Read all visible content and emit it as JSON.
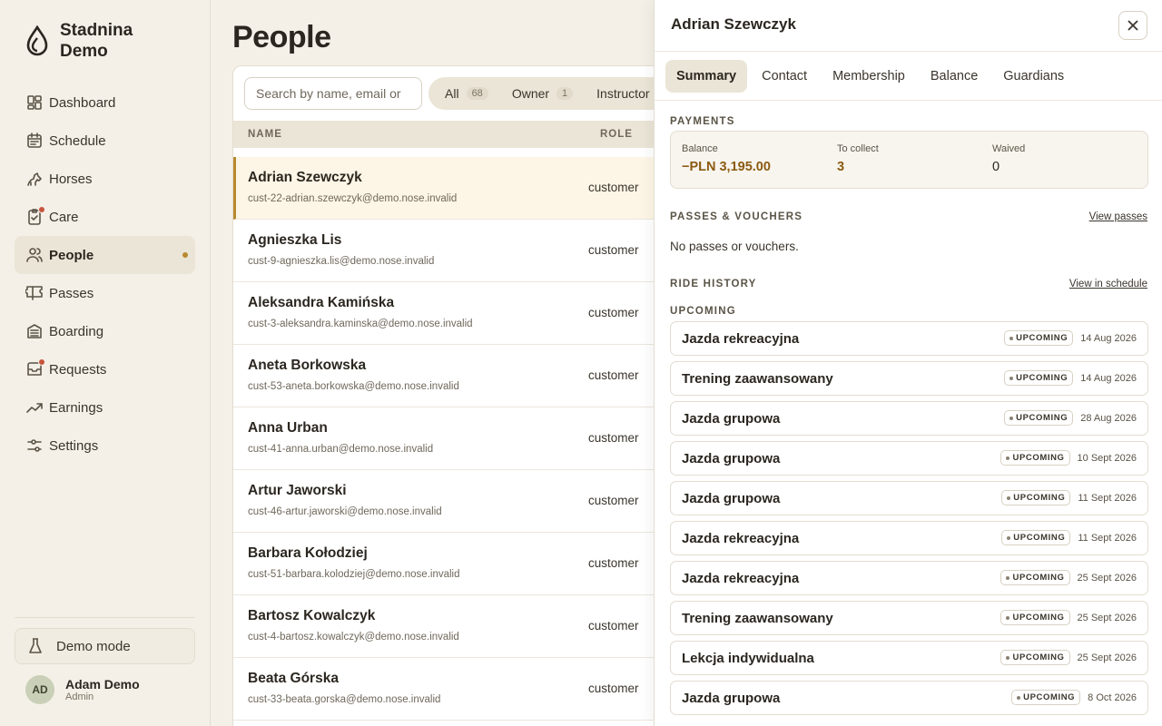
{
  "brand": {
    "name": "Stadnina Demo"
  },
  "nav": [
    {
      "label": "Dashboard",
      "icon": "dashboard-icon",
      "active": false,
      "badge": false
    },
    {
      "label": "Schedule",
      "icon": "calendar-icon",
      "active": false,
      "badge": false
    },
    {
      "label": "Horses",
      "icon": "horse-icon",
      "active": false,
      "badge": false
    },
    {
      "label": "Care",
      "icon": "clipboard-icon",
      "active": false,
      "badge": true
    },
    {
      "label": "People",
      "icon": "users-icon",
      "active": true,
      "badge": false
    },
    {
      "label": "Passes",
      "icon": "ticket-icon",
      "active": false,
      "badge": false
    },
    {
      "label": "Boarding",
      "icon": "building-icon",
      "active": false,
      "badge": false
    },
    {
      "label": "Requests",
      "icon": "inbox-icon",
      "active": false,
      "badge": true
    },
    {
      "label": "Earnings",
      "icon": "trend-icon",
      "active": false,
      "badge": false
    },
    {
      "label": "Settings",
      "icon": "sliders-icon",
      "active": false,
      "badge": false
    }
  ],
  "demo": {
    "label": "Demo mode"
  },
  "user": {
    "initials": "AD",
    "name": "Adam Demo",
    "role": "Admin"
  },
  "page": {
    "title": "People"
  },
  "search": {
    "placeholder": "Search by name, email or"
  },
  "filters": [
    {
      "label": "All",
      "count": "68"
    },
    {
      "label": "Owner",
      "count": "1"
    },
    {
      "label": "Instructor",
      "count": ""
    }
  ],
  "table": {
    "headers": {
      "name": "NAME",
      "role": "ROLE"
    },
    "rows": [
      {
        "name": "Adrian Szewczyk",
        "email": "cust-22-adrian.szewczyk@demo.nose.invalid",
        "role": "customer",
        "selected": true
      },
      {
        "name": "Agnieszka Lis",
        "email": "cust-9-agnieszka.lis@demo.nose.invalid",
        "role": "customer",
        "selected": false
      },
      {
        "name": "Aleksandra Kamińska",
        "email": "cust-3-aleksandra.kaminska@demo.nose.invalid",
        "role": "customer",
        "selected": false
      },
      {
        "name": "Aneta Borkowska",
        "email": "cust-53-aneta.borkowska@demo.nose.invalid",
        "role": "customer",
        "selected": false
      },
      {
        "name": "Anna Urban",
        "email": "cust-41-anna.urban@demo.nose.invalid",
        "role": "customer",
        "selected": false
      },
      {
        "name": "Artur Jaworski",
        "email": "cust-46-artur.jaworski@demo.nose.invalid",
        "role": "customer",
        "selected": false
      },
      {
        "name": "Barbara Kołodziej",
        "email": "cust-51-barbara.kolodziej@demo.nose.invalid",
        "role": "customer",
        "selected": false
      },
      {
        "name": "Bartosz Kowalczyk",
        "email": "cust-4-bartosz.kowalczyk@demo.nose.invalid",
        "role": "customer",
        "selected": false
      },
      {
        "name": "Beata Górska",
        "email": "cust-33-beata.gorska@demo.nose.invalid",
        "role": "customer",
        "selected": false
      }
    ]
  },
  "panel": {
    "title": "Adrian Szewczyk",
    "tabs": [
      {
        "label": "Summary",
        "active": true
      },
      {
        "label": "Contact",
        "active": false
      },
      {
        "label": "Membership",
        "active": false
      },
      {
        "label": "Balance",
        "active": false
      },
      {
        "label": "Guardians",
        "active": false
      }
    ],
    "payments": {
      "label": "PAYMENTS",
      "balance_label": "Balance",
      "balance_value": "−PLN 3,195.00",
      "collect_label": "To collect",
      "collect_value": "3",
      "waived_label": "Waived",
      "waived_value": "0"
    },
    "passes": {
      "label": "PASSES & VOUCHERS",
      "link": "View passes",
      "empty": "No passes or vouchers."
    },
    "history": {
      "label": "RIDE HISTORY",
      "link": "View in schedule",
      "upcoming_label": "UPCOMING",
      "rides": [
        {
          "name": "Jazda rekreacyjna",
          "status": "UPCOMING",
          "date": "14 Aug 2026"
        },
        {
          "name": "Trening zaawansowany",
          "status": "UPCOMING",
          "date": "14 Aug 2026"
        },
        {
          "name": "Jazda grupowa",
          "status": "UPCOMING",
          "date": "28 Aug 2026"
        },
        {
          "name": "Jazda grupowa",
          "status": "UPCOMING",
          "date": "10 Sept 2026"
        },
        {
          "name": "Jazda grupowa",
          "status": "UPCOMING",
          "date": "11 Sept 2026"
        },
        {
          "name": "Jazda rekreacyjna",
          "status": "UPCOMING",
          "date": "11 Sept 2026"
        },
        {
          "name": "Jazda rekreacyjna",
          "status": "UPCOMING",
          "date": "25 Sept 2026"
        },
        {
          "name": "Trening zaawansowany",
          "status": "UPCOMING",
          "date": "25 Sept 2026"
        },
        {
          "name": "Lekcja indywidualna",
          "status": "UPCOMING",
          "date": "25 Sept 2026"
        },
        {
          "name": "Jazda grupowa",
          "status": "UPCOMING",
          "date": "8 Oct 2026"
        }
      ]
    }
  },
  "colors": {
    "accent": "#b8892e",
    "badge_red": "#c8553d",
    "negative": "#8b5a12",
    "surface": "#f4f0e7"
  }
}
